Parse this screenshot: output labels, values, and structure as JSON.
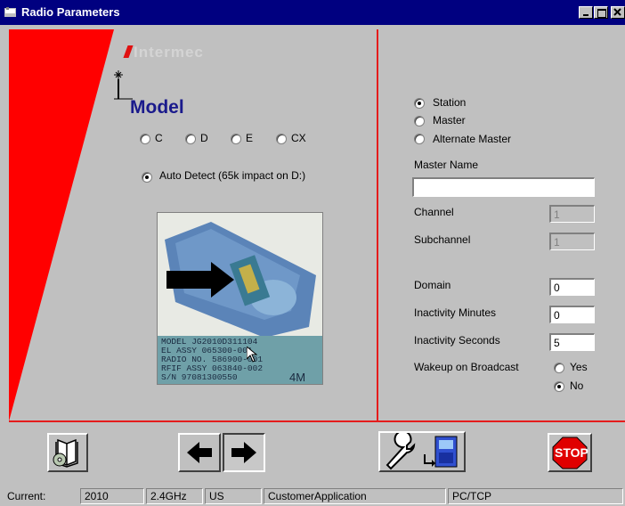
{
  "window": {
    "title": "Radio Parameters",
    "icon": "window-app-icon",
    "controls": [
      "minimize",
      "maximize",
      "close"
    ]
  },
  "brand": {
    "logo_text": "Intermec"
  },
  "model": {
    "heading": "Model",
    "options": [
      "C",
      "D",
      "E",
      "CX"
    ],
    "auto_detect_label": "Auto Detect (65k impact on D:)",
    "auto_detect_selected": true
  },
  "photo": {
    "label_lines": [
      "MODEL    JG2010D311104",
      "EL ASSY  065300-001",
      "RADIO NO. 586900-001",
      "RFIF ASSY 063840-002",
      "S/N    97081300550"
    ],
    "tag": "4M"
  },
  "mode": {
    "options": [
      {
        "label": "Station",
        "selected": true
      },
      {
        "label": "Master",
        "selected": false
      },
      {
        "label": "Alternate Master",
        "selected": false
      }
    ]
  },
  "fields": {
    "master_name_label": "Master Name",
    "master_name_value": "",
    "channel_label": "Channel",
    "channel_value": "1",
    "subchannel_label": "Subchannel",
    "subchannel_value": "1",
    "domain_label": "Domain",
    "domain_value": "0",
    "inactivity_minutes_label": "Inactivity Minutes",
    "inactivity_minutes_value": "0",
    "inactivity_seconds_label": "Inactivity Seconds",
    "inactivity_seconds_value": "5",
    "wakeup_label": "Wakeup on Broadcast",
    "wakeup_yes": "Yes",
    "wakeup_no": "No",
    "wakeup_selected": "No"
  },
  "toolbar": {
    "help_icon": "book-cd-icon",
    "back_icon": "arrow-left-icon",
    "forward_icon": "arrow-right-icon",
    "config_icon": "wrench-terminal-icon",
    "stop_label": "STOP"
  },
  "status": {
    "current_label": "Current:",
    "cells": [
      "2010",
      "2.4GHz",
      "US",
      "CustomerApplication",
      "PC/TCP"
    ]
  },
  "colors": {
    "title_bar": "#000080",
    "accent_red": "#ff0000",
    "model_text": "#1a1a8c"
  }
}
